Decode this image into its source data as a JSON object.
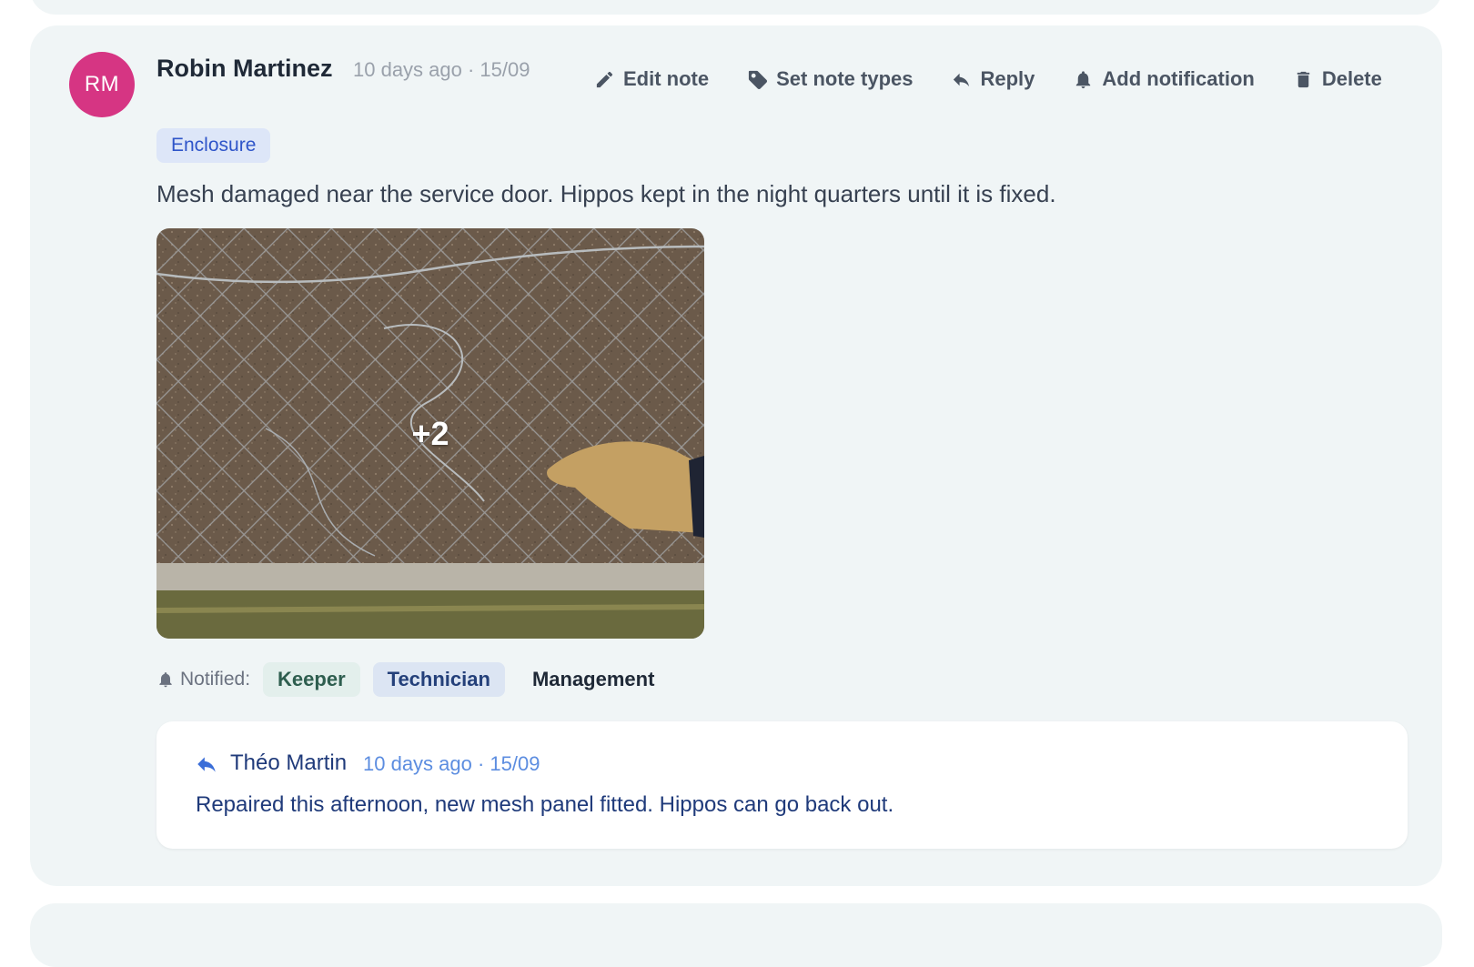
{
  "note": {
    "avatar_initials": "RM",
    "author": "Robin Martinez",
    "meta": "10 days ago · 15/09",
    "actions": {
      "edit": "Edit note",
      "set_types": "Set note types",
      "reply": "Reply",
      "add_notification": "Add notification",
      "delete": "Delete"
    },
    "tag": "Enclosure",
    "text": "Mesh damaged near the service door. Hippos kept in the night quarters until it is fixed.",
    "photo_more_count": "+2",
    "notified_label": "Notified:",
    "notified": [
      "Keeper",
      "Technician",
      "Management"
    ]
  },
  "reply": {
    "author": "Théo Martin",
    "meta": "10 days ago · 15/09",
    "text": "Repaired this afternoon, new mesh panel fitted. Hippos can go back out."
  },
  "colors": {
    "avatar": "#d63583",
    "tag_bg": "#dde6f8",
    "tag_text": "#2f55c9",
    "reply_accent": "#3b6ed8"
  }
}
